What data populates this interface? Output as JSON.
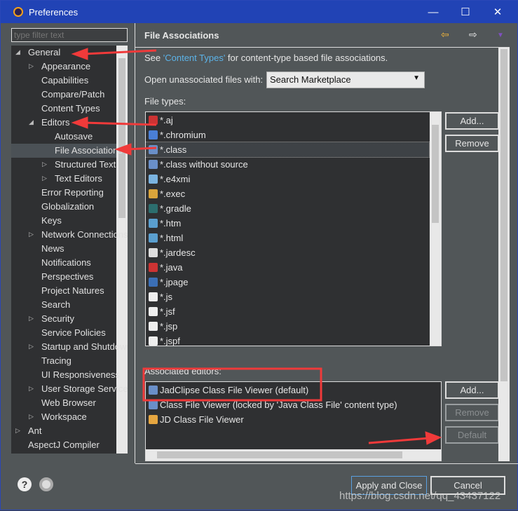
{
  "window": {
    "title": "Preferences",
    "minimize": "—",
    "maximize": "☐",
    "close": "✕"
  },
  "filter": {
    "placeholder": "type filter text"
  },
  "tree": [
    {
      "label": "General",
      "depth": 0,
      "tw": "open"
    },
    {
      "label": "Appearance",
      "depth": 1,
      "tw": "closed"
    },
    {
      "label": "Capabilities",
      "depth": 1,
      "tw": ""
    },
    {
      "label": "Compare/Patch",
      "depth": 1,
      "tw": ""
    },
    {
      "label": "Content Types",
      "depth": 1,
      "tw": ""
    },
    {
      "label": "Editors",
      "depth": 1,
      "tw": "open"
    },
    {
      "label": "Autosave",
      "depth": 2,
      "tw": ""
    },
    {
      "label": "File Associations",
      "depth": 2,
      "tw": "",
      "selected": true
    },
    {
      "label": "Structured Text",
      "depth": 2,
      "tw": "closed"
    },
    {
      "label": "Text Editors",
      "depth": 2,
      "tw": "closed"
    },
    {
      "label": "Error Reporting",
      "depth": 1,
      "tw": ""
    },
    {
      "label": "Globalization",
      "depth": 1,
      "tw": ""
    },
    {
      "label": "Keys",
      "depth": 1,
      "tw": ""
    },
    {
      "label": "Network Connections",
      "depth": 1,
      "tw": "closed"
    },
    {
      "label": "News",
      "depth": 1,
      "tw": ""
    },
    {
      "label": "Notifications",
      "depth": 1,
      "tw": ""
    },
    {
      "label": "Perspectives",
      "depth": 1,
      "tw": ""
    },
    {
      "label": "Project Natures",
      "depth": 1,
      "tw": ""
    },
    {
      "label": "Search",
      "depth": 1,
      "tw": ""
    },
    {
      "label": "Security",
      "depth": 1,
      "tw": "closed"
    },
    {
      "label": "Service Policies",
      "depth": 1,
      "tw": ""
    },
    {
      "label": "Startup and Shutdown",
      "depth": 1,
      "tw": "closed"
    },
    {
      "label": "Tracing",
      "depth": 1,
      "tw": ""
    },
    {
      "label": "UI Responsiveness",
      "depth": 1,
      "tw": ""
    },
    {
      "label": "User Storage Service",
      "depth": 1,
      "tw": "closed"
    },
    {
      "label": "Web Browser",
      "depth": 1,
      "tw": ""
    },
    {
      "label": "Workspace",
      "depth": 1,
      "tw": "closed"
    },
    {
      "label": "Ant",
      "depth": 0,
      "tw": "closed"
    },
    {
      "label": "AspectJ Compiler",
      "depth": 0,
      "tw": ""
    }
  ],
  "page": {
    "title": "File Associations",
    "see_prefix": "See ",
    "see_link": "'Content Types'",
    "see_suffix": " for content-type based file associations.",
    "open_label": "Open unassociated files with:",
    "open_value": "Search Marketplace",
    "file_types_label": "File types:",
    "file_types": [
      {
        "name": "*.aj",
        "color": "#c33"
      },
      {
        "name": "*.chromium",
        "color": "#4a7fd6"
      },
      {
        "name": "*.class",
        "color": "#6a8fc8",
        "selected": true
      },
      {
        "name": "*.class without source",
        "color": "#6a8fc8"
      },
      {
        "name": "*.e4xmi",
        "color": "#7ab3e0"
      },
      {
        "name": "*.exec",
        "color": "#d9a43b"
      },
      {
        "name": "*.gradle",
        "color": "#2c6e6e"
      },
      {
        "name": "*.htm",
        "color": "#5a9fcf"
      },
      {
        "name": "*.html",
        "color": "#5a9fcf"
      },
      {
        "name": "*.jardesc",
        "color": "#ddd"
      },
      {
        "name": "*.java",
        "color": "#c33"
      },
      {
        "name": "*.jpage",
        "color": "#3b6fb6"
      },
      {
        "name": "*.js",
        "color": "#eee"
      },
      {
        "name": "*.jsf",
        "color": "#eee"
      },
      {
        "name": "*.jsp",
        "color": "#eee"
      },
      {
        "name": "*.jspf",
        "color": "#eee"
      }
    ],
    "file_add": "Add...",
    "file_remove": "Remove",
    "editors_label": "Associated editors:",
    "editors": [
      {
        "name": "JadClipse Class File Viewer (default)",
        "color": "#6a8fc8"
      },
      {
        "name": "Class File Viewer (locked by 'Java Class File' content type)",
        "color": "#6a8fc8"
      },
      {
        "name": "JD Class File Viewer",
        "color": "#e6a640"
      }
    ],
    "editor_add": "Add...",
    "editor_remove": "Remove",
    "editor_default": "Default"
  },
  "footer": {
    "help": "?",
    "apply_close": "Apply and Close",
    "cancel": "Cancel"
  },
  "watermark": "https://blog.csdn.net/qq_43437122",
  "colors": {
    "titlebar": "#2143b5",
    "annotation": "#f03a3a",
    "link": "#5cb3e8"
  }
}
